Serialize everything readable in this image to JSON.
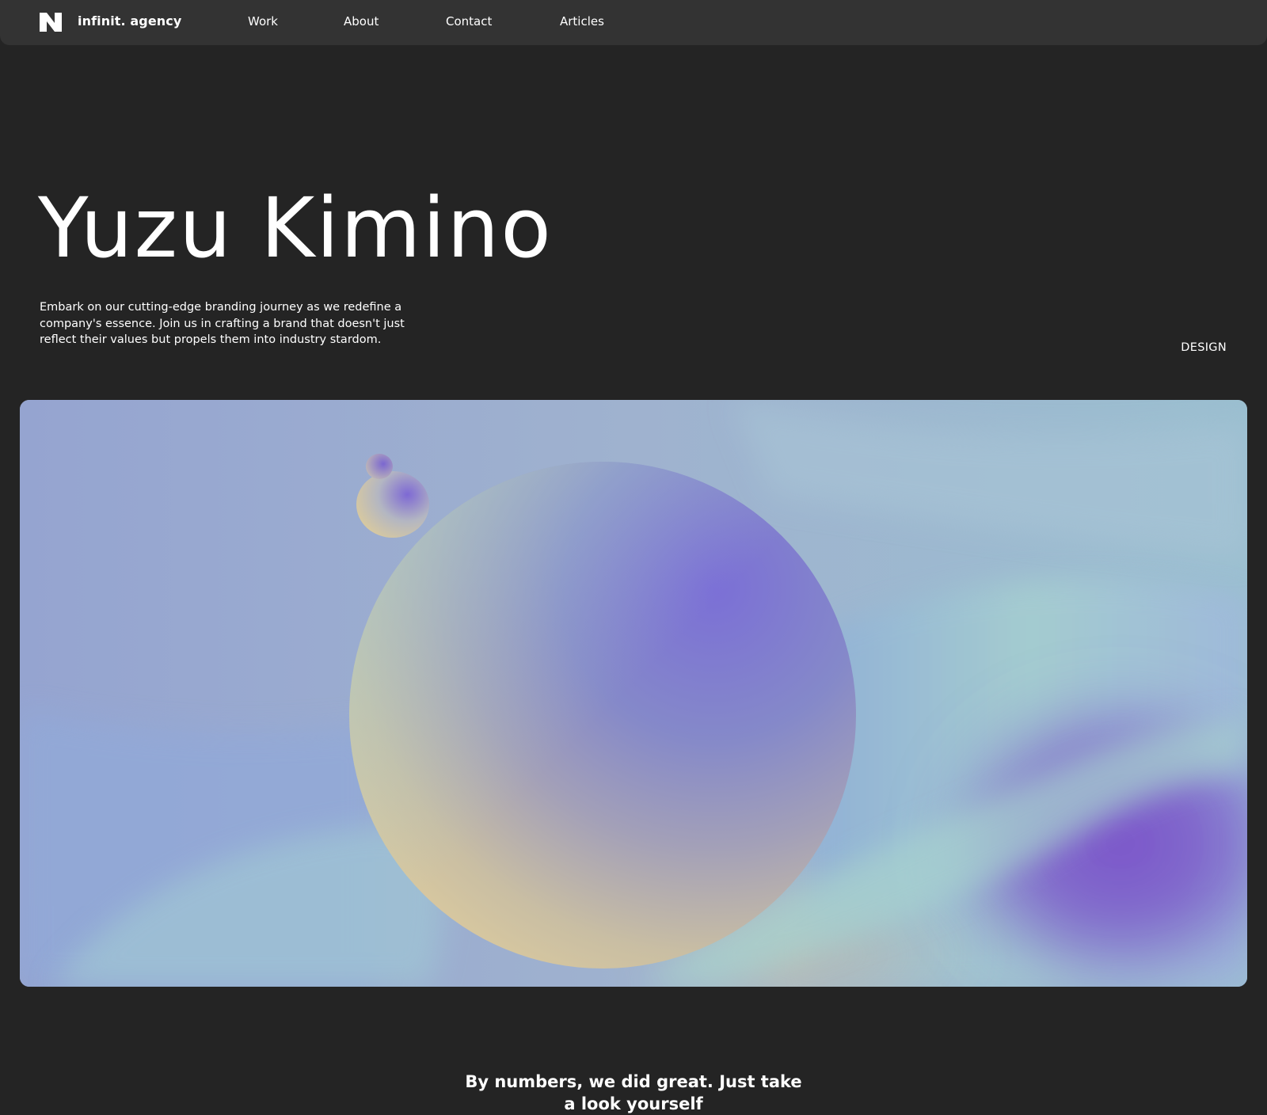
{
  "header": {
    "logo_icon": "agency-logo-icon",
    "brand": "infinit. agency",
    "nav": [
      {
        "label": "Work"
      },
      {
        "label": "About"
      },
      {
        "label": "Contact"
      },
      {
        "label": "Articles"
      }
    ]
  },
  "hero": {
    "title": "Yuzu Kimino",
    "description": "Embark on our cutting-edge branding journey as we redefine a company's essence. Join us in crafting a brand that doesn't just reflect their values but propels them into industry stardom.",
    "category": "DESIGN"
  },
  "showcase": {
    "image_icon": "abstract-spheres-artwork",
    "colors": {
      "periwinkle": "#8fa3d3",
      "violet": "#7b52c8",
      "mint": "#a9d2cf",
      "peach": "#d9c49a"
    }
  },
  "numbers": {
    "heading_line1": "By numbers, we did great. Just take",
    "heading_line2": "a look yourself"
  },
  "theme": {
    "background": "#242424",
    "topbar": "#333333",
    "text": "#ffffff"
  }
}
